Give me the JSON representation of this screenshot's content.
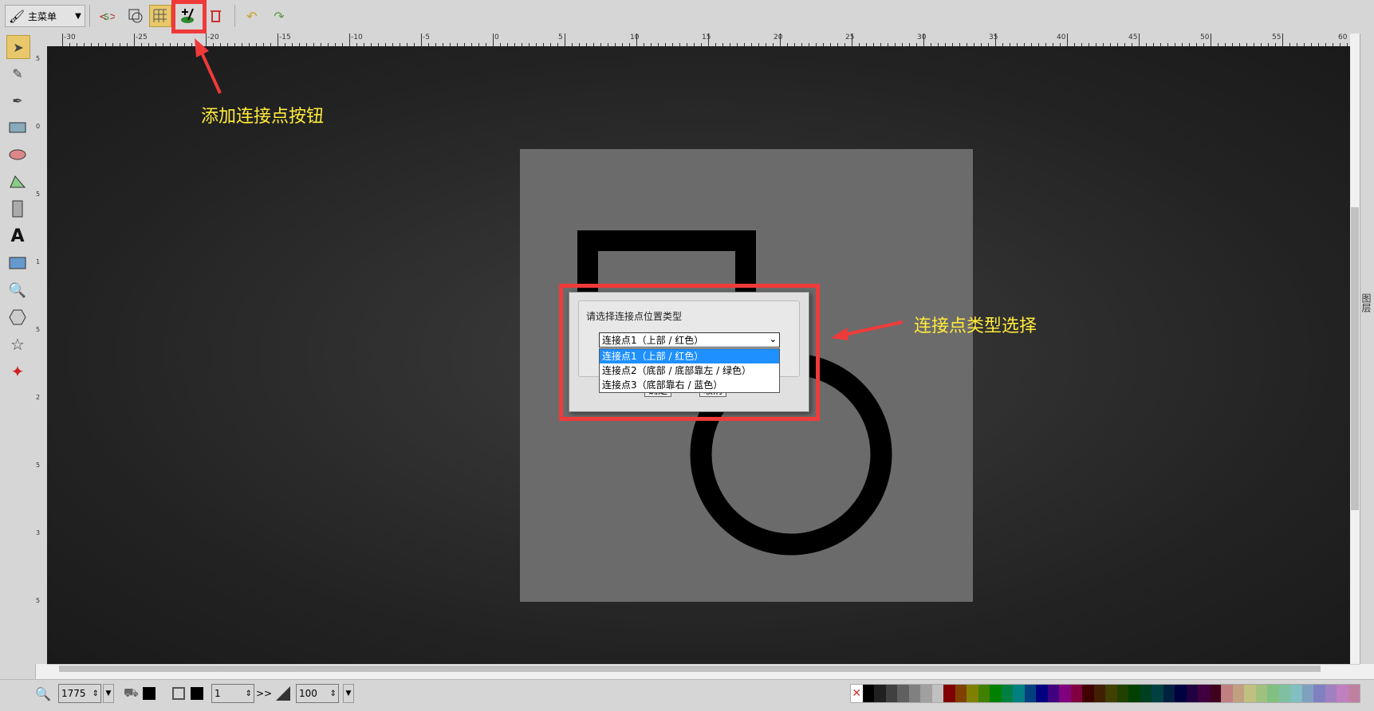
{
  "toolbar": {
    "main_menu_label": "主菜单",
    "buttons": [
      "source-icon",
      "group-icon",
      "grid-icon",
      "add-connector-point-icon",
      "delete-connector-icon",
      "undo-icon",
      "redo-icon"
    ]
  },
  "tools": [
    "select-icon",
    "pencil-icon",
    "pen-icon",
    "rect-icon",
    "ellipse-icon",
    "path-icon",
    "shapes-icon",
    "text-icon",
    "image-icon",
    "zoom-icon",
    "polygon-icon",
    "star-icon",
    "connector-icon"
  ],
  "ruler_top": [
    "-30",
    "-25",
    "-20",
    "-15",
    "-10",
    "-5",
    "0",
    "5",
    "10",
    "15",
    "20",
    "25",
    "30",
    "35",
    "40",
    "45",
    "50",
    "55",
    "60"
  ],
  "layers_tab_label": "图层",
  "annotations": {
    "add_connector_label": "添加连接点按钮",
    "connector_type_label": "连接点类型选择"
  },
  "dialog": {
    "prompt": "请选择连接点位置类型",
    "selected": "连接点1（上部 / 红色）",
    "options": [
      "连接点1（上部 / 红色）",
      "连接点2（底部 / 底部靠左 / 绿色）",
      "连接点3（底部靠右 / 蓝色）"
    ],
    "ok_label": "确定",
    "cancel_label": "取消"
  },
  "bottom": {
    "zoom_value": "1775",
    "stroke_width": "1",
    "opacity": "100",
    "fill_color": "#000000",
    "stroke_color": "#000000"
  },
  "palette": [
    "#000000",
    "#202020",
    "#404040",
    "#606060",
    "#808080",
    "#a0a0a0",
    "#c0c0c0",
    "#800000",
    "#804000",
    "#808000",
    "#408000",
    "#008000",
    "#008040",
    "#008080",
    "#004080",
    "#000080",
    "#400080",
    "#800080",
    "#800040",
    "#400000",
    "#402000",
    "#404000",
    "#204000",
    "#004000",
    "#004020",
    "#004040",
    "#002040",
    "#000040",
    "#200040",
    "#400040",
    "#400020",
    "#c08080",
    "#c0a080",
    "#c0c080",
    "#a0c080",
    "#80c080",
    "#80c0a0",
    "#80c0c0",
    "#80a0c0",
    "#8080c0",
    "#a080c0",
    "#c080c0",
    "#c080a0"
  ]
}
